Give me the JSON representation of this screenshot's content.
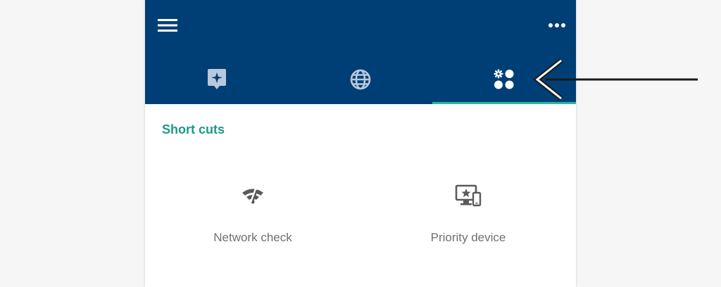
{
  "appbar": {
    "background_color": "#003f76",
    "menu_icon": "hamburger-menu-icon",
    "more_icon": "more-horizontal-icon"
  },
  "tabs": [
    {
      "icon": "star-location-icon",
      "selected": false
    },
    {
      "icon": "globe-icon",
      "selected": false
    },
    {
      "icon": "apps-settings-icon",
      "selected": true
    }
  ],
  "tab_indicator_color": "#2bb5a0",
  "section": {
    "title": "Short cuts",
    "title_color": "#1b9a86"
  },
  "shortcuts": [
    {
      "label": "Network check",
      "icon": "wifi-off-icon"
    },
    {
      "label": "Priority device",
      "icon": "priority-device-icon"
    }
  ],
  "annotation": {
    "icon": "arrow-left-icon",
    "points_to": "apps-settings-tab"
  }
}
